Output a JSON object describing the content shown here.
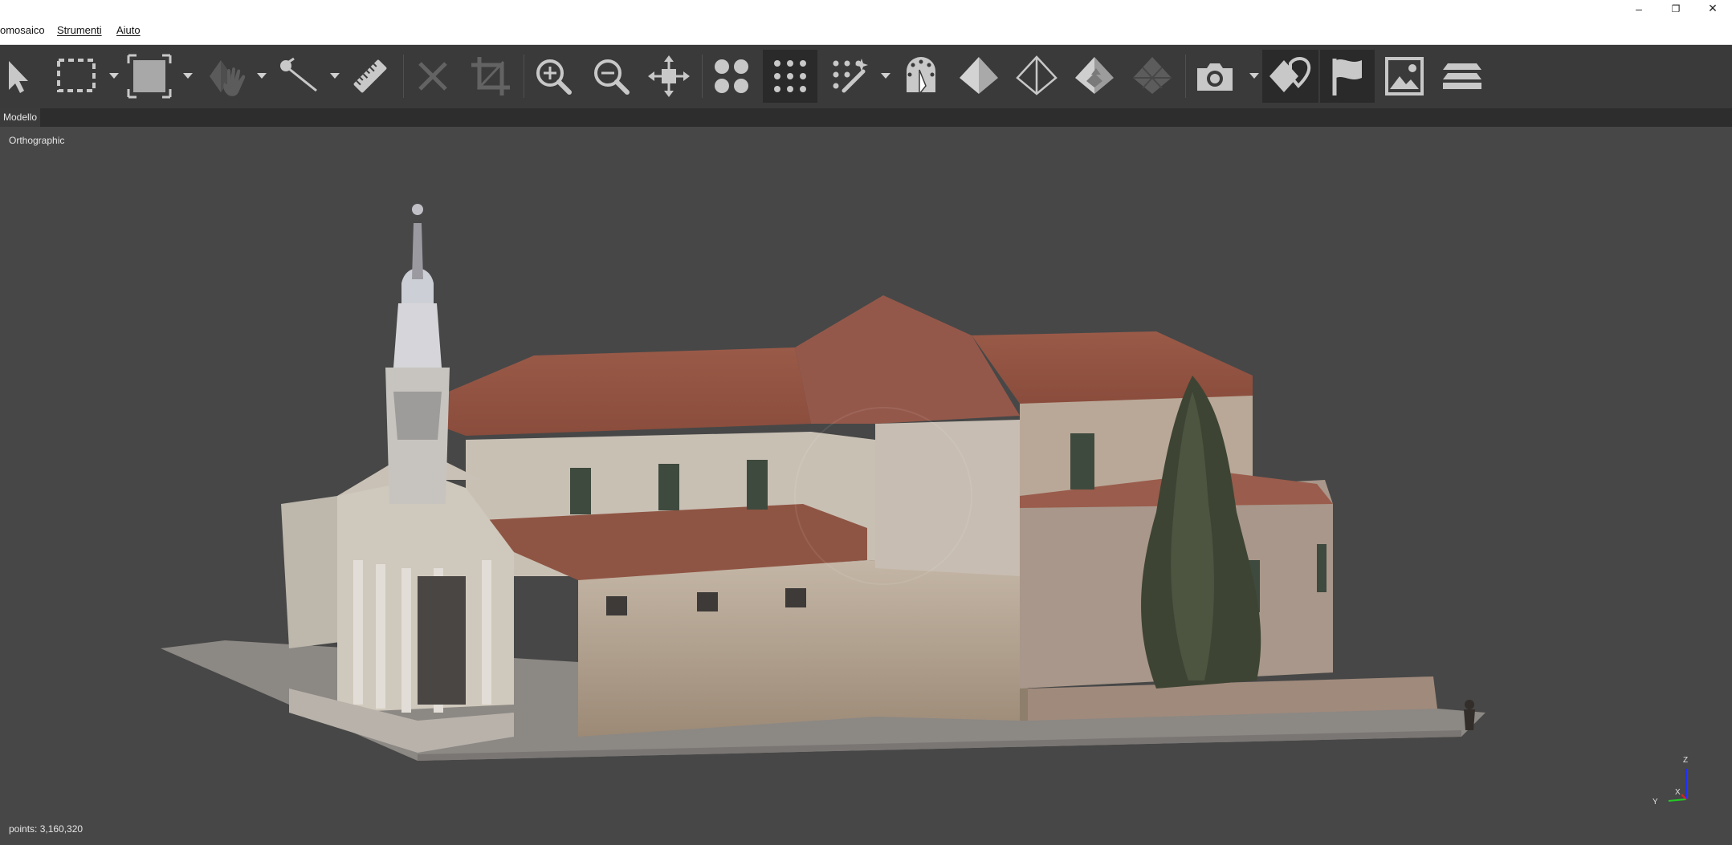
{
  "titlebar": {
    "minimize": "–",
    "restore": "❐",
    "close": "✕"
  },
  "menu": {
    "items": [
      {
        "label": "omosaico"
      },
      {
        "label": "Strumenti"
      },
      {
        "label": "Aiuto"
      }
    ]
  },
  "toolbar": {
    "buttons": [
      "select-icon",
      "rectangle-select-icon",
      "shape-select-icon",
      "navigate-hand-icon",
      "measure-icon",
      "ruler-icon",
      "delete-icon",
      "crop-icon",
      "zoom-in-icon",
      "zoom-out-icon",
      "reset-view-icon",
      "point-cloud-icon",
      "dense-cloud-icon",
      "classify-points-icon",
      "tie-points-icon",
      "solid-model-icon",
      "wireframe-model-icon",
      "textured-model-icon",
      "tiled-model-icon",
      "camera-icon",
      "shapes-icon",
      "markers-flag-icon",
      "image-icon",
      "layers-icon"
    ]
  },
  "tabs": [
    {
      "label": "Modello"
    }
  ],
  "viewport": {
    "projection": "Orthographic",
    "points_text": "points: 3,160,320",
    "axes": {
      "z": "Z",
      "x": "X",
      "y": "Y"
    }
  }
}
